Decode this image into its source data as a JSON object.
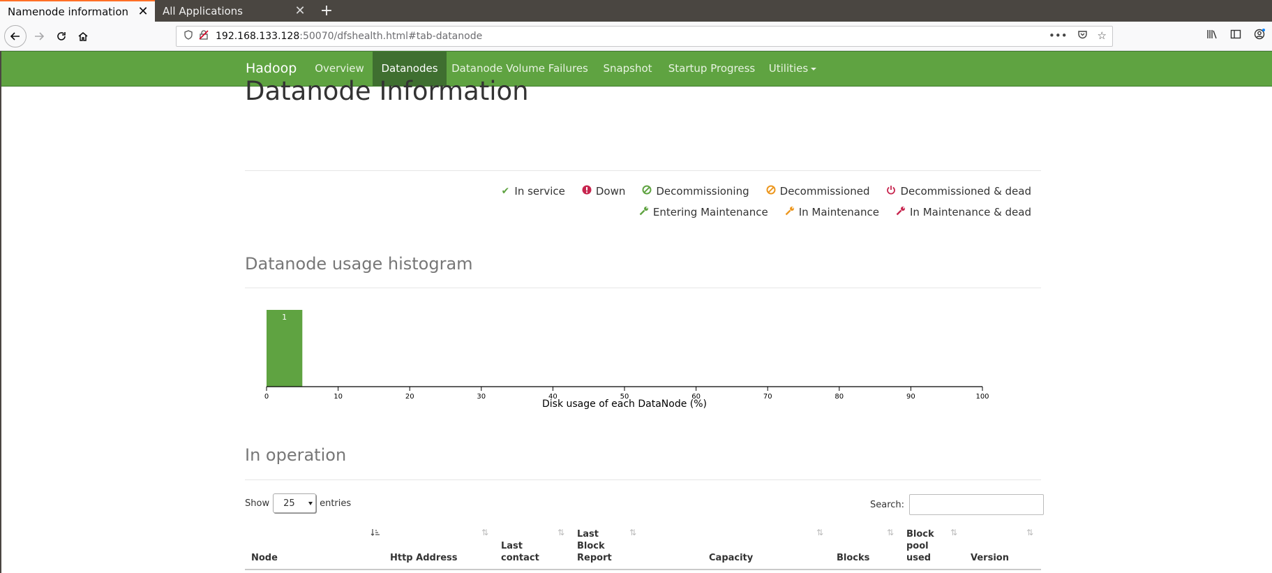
{
  "browser": {
    "tabs": [
      {
        "title": "Namenode information",
        "active": true
      },
      {
        "title": "All Applications",
        "active": false
      }
    ],
    "close_glyph": "✕",
    "new_tab_glyph": "+",
    "url_host": "192.168.133.128",
    "url_rest": ":50070/dfshealth.html#tab-datanode"
  },
  "navbar": {
    "brand": "Hadoop",
    "items": [
      {
        "label": "Overview",
        "active": false
      },
      {
        "label": "Datanodes",
        "active": true
      },
      {
        "label": "Datanode Volume Failures",
        "active": false
      },
      {
        "label": "Snapshot",
        "active": false
      },
      {
        "label": "Startup Progress",
        "active": false
      },
      {
        "label": "Utilities",
        "active": false,
        "dropdown": true
      }
    ],
    "color": "#5fa341",
    "active_color": "#3f6f30"
  },
  "page": {
    "title": "Datanode Information",
    "legend_row1": [
      {
        "label": "In service",
        "icon": "check-icon",
        "color": "#5fa341"
      },
      {
        "label": "Down",
        "icon": "exclamation-circle-icon",
        "color": "#c7254e"
      },
      {
        "label": "Decommissioning",
        "icon": "ban-icon",
        "color": "#5fa341"
      },
      {
        "label": "Decommissioned",
        "icon": "ban-icon",
        "color": "#ec971f"
      },
      {
        "label": "Decommissioned & dead",
        "icon": "power-icon",
        "color": "#c7254e"
      }
    ],
    "legend_row2": [
      {
        "label": "Entering Maintenance",
        "icon": "wrench-icon",
        "color": "#5fa341"
      },
      {
        "label": "In Maintenance",
        "icon": "wrench-icon",
        "color": "#ec971f"
      },
      {
        "label": "In Maintenance & dead",
        "icon": "wrench-icon",
        "color": "#c7254e"
      }
    ],
    "histogram_heading": "Datanode usage histogram",
    "operation_heading": "In operation",
    "table": {
      "show_label": "Show",
      "entries_value": "25",
      "entries_label": "entries",
      "search_label": "Search:",
      "columns": [
        "Node",
        "Http Address",
        "Last contact",
        "Last Block Report",
        "Capacity",
        "Blocks",
        "Block pool used",
        "Version"
      ]
    }
  },
  "chart_data": {
    "type": "bar",
    "bins": [
      [
        0,
        5
      ]
    ],
    "values": [
      1
    ],
    "data_labels": [
      "1"
    ],
    "xlabel": "Disk usage of each DataNode (%)",
    "xlim": [
      0,
      100
    ],
    "xticks": [
      0,
      10,
      20,
      30,
      40,
      50,
      60,
      70,
      80,
      90,
      100
    ],
    "bar_color": "#5fa341"
  }
}
